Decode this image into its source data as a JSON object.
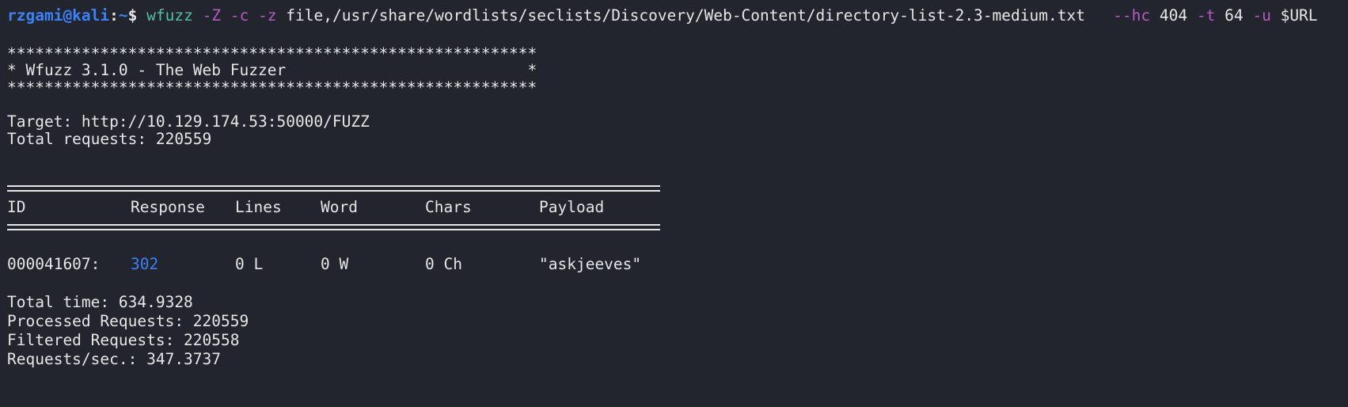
{
  "prompt": {
    "user_host": "rzgami@kali",
    "separator": ":",
    "path": "~",
    "dollar": "$"
  },
  "command": {
    "program": "wfuzz",
    "flag_Z": "-Z",
    "flag_c": "-c",
    "flag_z": "-z",
    "wordlist_arg": "file,/usr/share/wordlists/seclists/Discovery/Web-Content/directory-list-2.3-medium.txt",
    "flag_hc": "--hc",
    "hc_value": "404",
    "flag_t": "-t",
    "t_value": "64",
    "flag_u": "-u",
    "u_value": "$URL"
  },
  "banner": {
    "stars": "*********************************************************",
    "title": "* Wfuzz 3.1.0 - The Web Fuzzer                          *"
  },
  "target_line": "Target: http://10.129.174.53:50000/FUZZ",
  "total_requests_line": "Total requests: 220559",
  "table": {
    "headers": [
      "ID",
      "Response",
      "Lines",
      "Word",
      "Chars",
      "Payload"
    ],
    "rows": [
      {
        "id": "000041607:",
        "response": "302",
        "lines": "0 L",
        "word": "0 W",
        "chars": "0 Ch",
        "payload": "\"askjeeves\""
      }
    ]
  },
  "summary": {
    "total_time": "Total time: 634.9328",
    "processed": "Processed Requests: 220559",
    "filtered": "Filtered Requests: 220558",
    "rate": "Requests/sec.: 347.3737"
  },
  "colors": {
    "background": "#22252e",
    "prompt": "#3b82f6",
    "command": "#53c0a0",
    "flag": "#b45bc4",
    "text": "#e6e6e6",
    "status_302": "#3b82f6"
  }
}
